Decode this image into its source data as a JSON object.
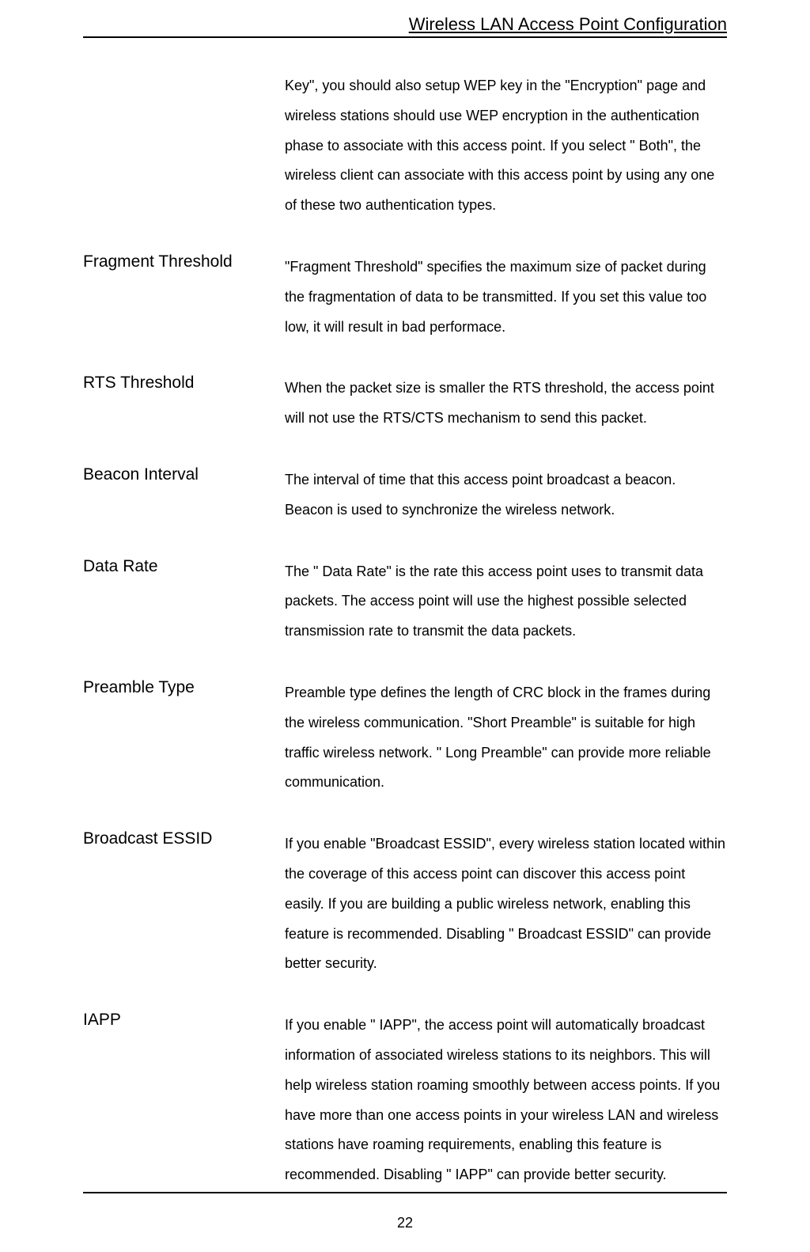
{
  "header_title": "Wireless LAN Access Point Configuration",
  "intro": "Key\", you should also setup WEP key in the \"Encryption\" page and wireless stations should use WEP encryption in the authentication phase to associate with this access point. If you select \" Both\", the wireless client can associate with this access point by using any one of these two authentication types.",
  "rows": [
    {
      "label": "Fragment Threshold",
      "desc": "\"Fragment Threshold\" specifies the maximum size of packet during the fragmentation of data to be transmitted. If you set this value too low, it will result in bad performace."
    },
    {
      "label": "RTS Threshold",
      "desc": "When the packet size is smaller the RTS threshold, the access point will not use the RTS/CTS mechanism to send this packet."
    },
    {
      "label": "Beacon Interval",
      "desc": "The interval of time that this access point broadcast a beacon. Beacon is used to synchronize the wireless network."
    },
    {
      "label": "Data Rate",
      "desc": "The \" Data Rate\" is the rate this access point uses to transmit data packets. The access point will use the highest possible selected transmission rate to transmit the data packets."
    },
    {
      "label": "Preamble Type",
      "desc": "Preamble type defines the length of CRC block in the frames during the wireless communication. \"Short Preamble\" is suitable for high traffic wireless network. \" Long Preamble\" can provide more reliable communication."
    },
    {
      "label": "Broadcast ESSID",
      "desc": "If you enable \"Broadcast ESSID\", every wireless station located within the coverage of this access point can discover this access point easily. If you are building a public wireless network, enabling this feature is recommended. Disabling \" Broadcast ESSID\" can provide better security."
    },
    {
      "label": "IAPP",
      "desc": "If you enable \" IAPP\", the access point will automatically broadcast information of associated wireless stations to its neighbors. This will help wireless station roaming smoothly between access points. If you have more than one access points in your wireless LAN and wireless stations have roaming requirements, enabling this feature is recommended. Disabling \" IAPP\" can provide better security."
    }
  ],
  "page_number": "22"
}
